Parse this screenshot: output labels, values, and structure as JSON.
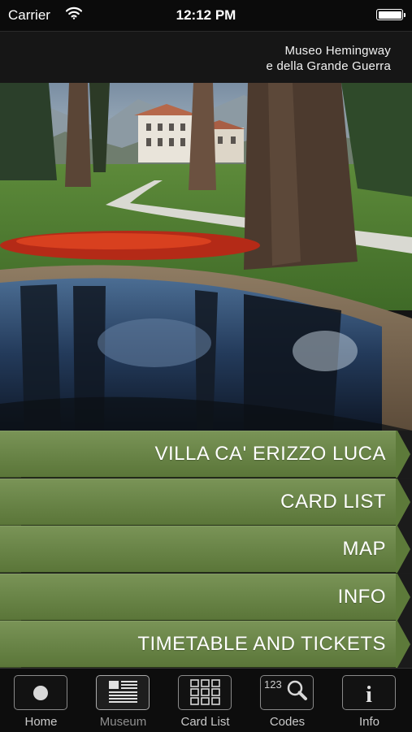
{
  "status_bar": {
    "carrier": "Carrier",
    "time": "12:12 PM",
    "icons": [
      "wifi-icon",
      "battery-icon"
    ]
  },
  "header": {
    "title_line1": "Museo Hemingway",
    "title_line2": "e della Grande Guerra"
  },
  "hero": {
    "description_icon": "villa-garden-photo"
  },
  "menu": {
    "items": [
      {
        "label": "VILLA CA' ERIZZO LUCA"
      },
      {
        "label": "CARD LIST"
      },
      {
        "label": "MAP"
      },
      {
        "label": "INFO"
      },
      {
        "label": "TIMETABLE AND TICKETS"
      }
    ]
  },
  "tabbar": {
    "selected": "Museum",
    "tabs": [
      {
        "label": "Home",
        "icon": "dot-icon"
      },
      {
        "label": "Museum",
        "icon": "newspaper-icon"
      },
      {
        "label": "Card List",
        "icon": "grid-icon"
      },
      {
        "label": "Codes",
        "icon": "code-search-icon",
        "icon_text": "123"
      },
      {
        "label": "Info",
        "icon": "info-icon",
        "icon_text": "i"
      }
    ]
  },
  "colors": {
    "menu_green": "#6b8649",
    "background": "#141414",
    "text": "#ffffff"
  }
}
